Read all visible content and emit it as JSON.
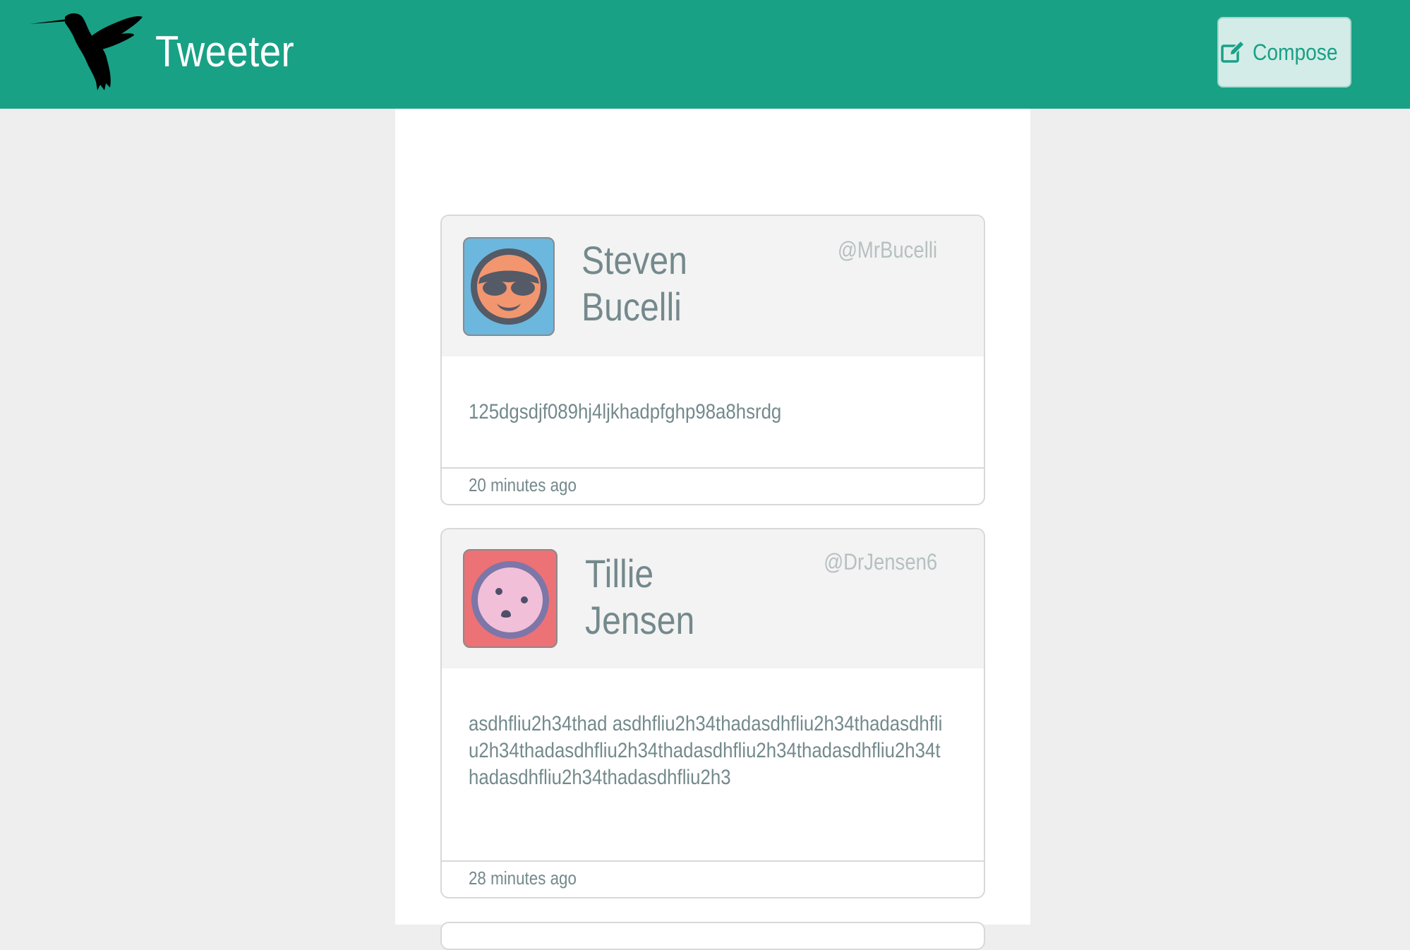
{
  "header": {
    "brand": "Tweeter",
    "logo_icon": "hummingbird-icon",
    "compose_label": "Compose",
    "compose_icon": "edit-icon"
  },
  "tweets": [
    {
      "name": "Steven Bucelli",
      "handle": "@MrBucelli",
      "avatar_icon": "sunglasses-face-avatar",
      "text": "125dgsdjf089hj4ljkhadpfghp98a8hsrdg",
      "time": "20 minutes ago"
    },
    {
      "name": "Tillie Jensen",
      "handle": "@DrJensen6",
      "avatar_icon": "worried-face-avatar",
      "text": "asdhfliu2h34thad asdhfliu2h34thadasdhfliu2h34thadasdhfliu2h34thadasdhfliu2h34thadasdhfliu2h34thadasdhfliu2h34thadasdhfliu2h34thadasdhfliu2h3",
      "time": "28 minutes ago"
    }
  ],
  "colors": {
    "brand": "#19a186",
    "page_background": "#eeeeee",
    "card_header": "#f3f3f3",
    "text": "#74898c",
    "handle": "#b7c0c1"
  }
}
